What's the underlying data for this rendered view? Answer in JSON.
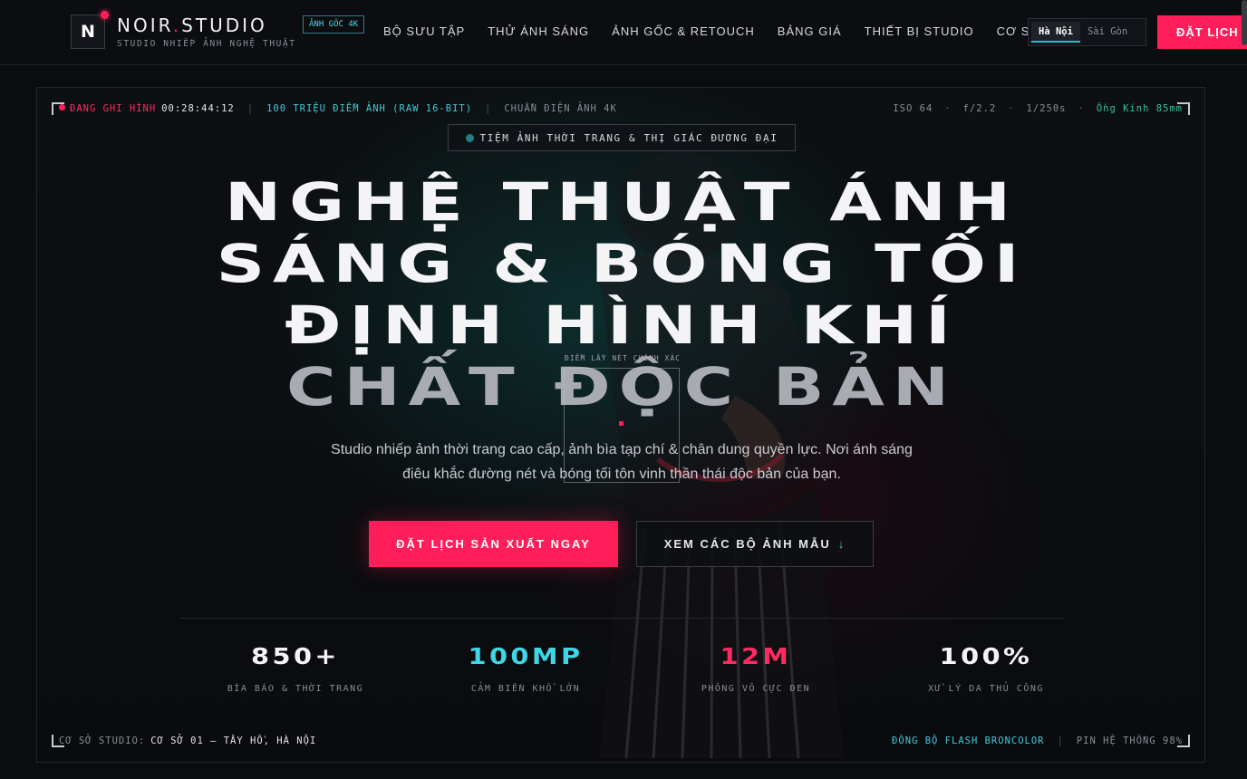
{
  "nav": {
    "logo_letter": "N",
    "brand_name": "NOIR",
    "brand_dot": ".",
    "brand_suffix": "STUDIO",
    "brand_sub": "STUDIO NHIẾP ẢNH NGHỆ THUẬT",
    "badge": "ẢNH GỐC 4K",
    "menu": [
      "BỘ SƯU TẬP",
      "THỬ ÁNH SÁNG",
      "ẢNH GỐC & RETOUCH",
      "BẢNG GIÁ",
      "THIẾT BỊ STUDIO",
      "CƠ SỞ & FAQ"
    ],
    "city_active": "Hà Nội",
    "city_inactive": "Sài Gòn",
    "cta": "ĐẶT LỊCH V"
  },
  "hud": {
    "rec_label": "ĐANG GHI HÌNH",
    "rec_time": "00:28:44:12",
    "megapixel": "100 TRIỆU ĐIỂM ẢNH (RAW 16-BIT)",
    "standard": "CHUẨN ĐIỆN ẢNH 4K",
    "iso": "ISO 64",
    "aperture": "f/2.2",
    "shutter": "1/250s",
    "lens": "Ống Kính 85mm",
    "location_label": "CƠ SỞ STUDIO:",
    "location": "CƠ SỞ 01 — TÂY HỒ, HÀ NỘI",
    "sync": "ĐỒNG BỘ FLASH BRONCOLOR",
    "battery": "PIN HỆ THỐNG 98%"
  },
  "hero": {
    "tagline": "TIỆM ẢNH THỜI TRANG & THỊ GIÁC ĐƯƠNG ĐẠI",
    "headline_lines": [
      "NGHỆ THUẬT ÁNH",
      "SÁNG & BÓNG TỐI",
      "ĐỊNH HÌNH KHÍ",
      "CHẤT ĐỘC BẢN"
    ],
    "focus_label": "ĐIỂM LẤY NÉT CHÍNH XÁC",
    "subtext_line1": "Studio nhiếp ảnh thời trang cao cấp, ảnh bìa tạp chí & chân dung quyền lực. Nơi ánh sáng",
    "subtext_line2": "điêu khắc đường nét và bóng tối tôn vinh thần thái độc bản của bạn.",
    "primary_cta": "ĐẶT LỊCH SẢN XUẤT NGAY",
    "secondary_cta": "XEM CÁC BỘ ẢNH MẪU",
    "secondary_arrow": "↓"
  },
  "stats": [
    {
      "value": "850+",
      "label": "BÌA BÁO & THỜI TRANG",
      "color": "#f4f4f6"
    },
    {
      "value": "100MP",
      "label": "CẢM BIẾN KHỔ LỚN",
      "color": "#3fd6e6"
    },
    {
      "value": "12M",
      "label": "PHÔNG VÔ CỰC ĐEN",
      "color": "#ff2a62"
    },
    {
      "value": "100%",
      "label": "XỬ LÝ DA THỦ CÔNG",
      "color": "#f4f4f6"
    }
  ],
  "colors": {
    "accent": "#ff1e5a",
    "cyan": "#44c9d8",
    "green": "#36c293",
    "bg": "#0b0c10"
  }
}
